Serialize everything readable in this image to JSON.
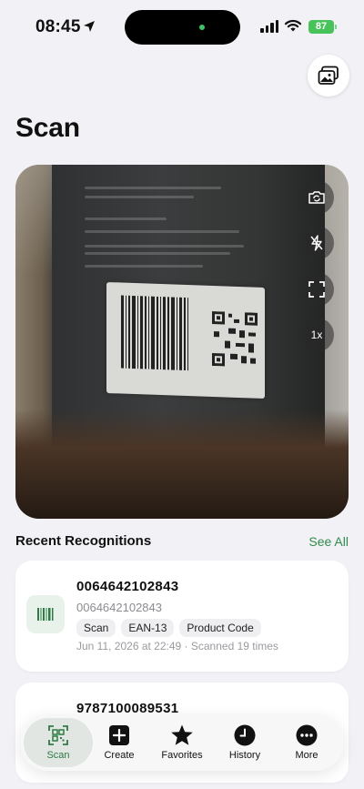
{
  "status": {
    "time": "08:45",
    "battery": "87"
  },
  "page_title": "Scan",
  "camera": {
    "zoom_label": "1x"
  },
  "recent": {
    "title": "Recent Recognitions",
    "see_all": "See All",
    "items": [
      {
        "code": "0064642102843",
        "sub": "0064642102843",
        "tags": [
          "Scan",
          "EAN-13",
          "Product Code"
        ],
        "meta": "Jun 11, 2026 at 22:49 · Scanned 19 times"
      },
      {
        "code": "9787100089531"
      }
    ]
  },
  "tabs": [
    {
      "label": "Scan",
      "icon": "qr-scan-icon",
      "active": true
    },
    {
      "label": "Create",
      "icon": "plus-square-icon"
    },
    {
      "label": "Favorites",
      "icon": "star-icon"
    },
    {
      "label": "History",
      "icon": "clock-icon"
    },
    {
      "label": "More",
      "icon": "ellipsis-icon"
    }
  ],
  "colors": {
    "accent": "#2f8a4c",
    "background": "#f2f2f6",
    "battery": "#47c35a"
  }
}
